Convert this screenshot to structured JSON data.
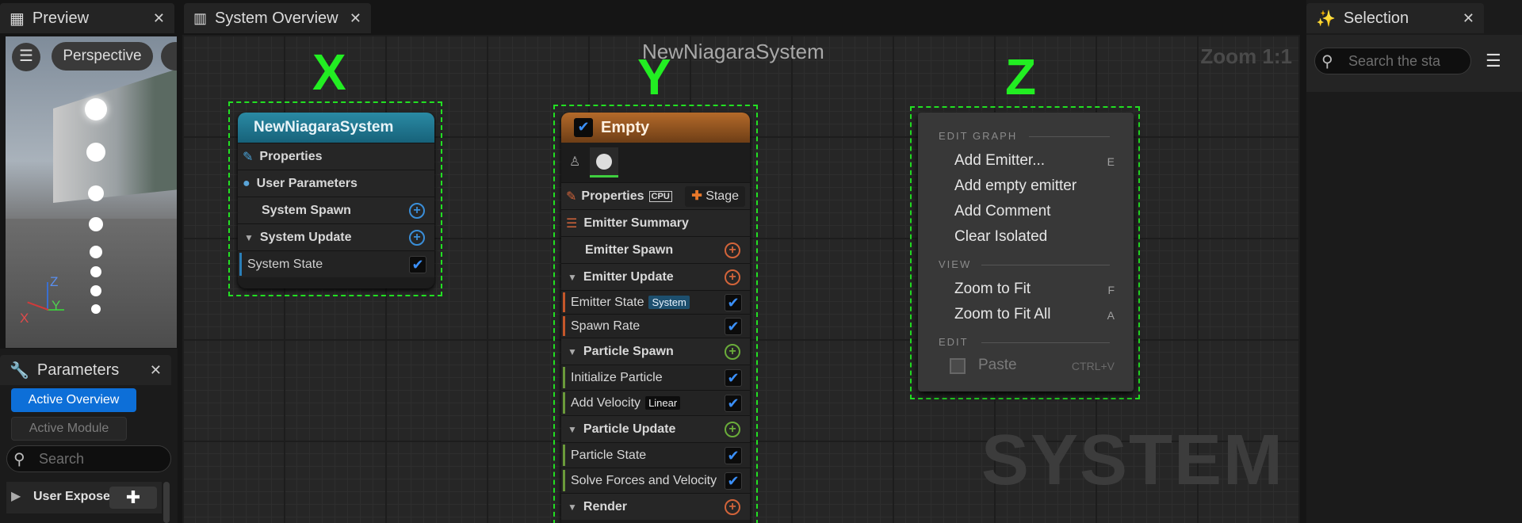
{
  "preview": {
    "tab_label": "Preview",
    "viewport_mode": "Perspective",
    "axes": {
      "z": "Z",
      "y": "Y",
      "x": "X"
    }
  },
  "parameters": {
    "tab_label": "Parameters",
    "active_overview": "Active Overview",
    "active_module": "Active Module",
    "search_placeholder": "Search",
    "user_exposed": "User Exposed"
  },
  "system_overview": {
    "tab_label": "System Overview",
    "title": "NewNiagaraSystem",
    "zoom": "Zoom 1:1",
    "watermark": "SYSTEM"
  },
  "annotations": {
    "x": "X",
    "y": "Y",
    "z": "Z"
  },
  "system_node": {
    "title": "NewNiagaraSystem",
    "rows": {
      "properties": "Properties",
      "user_parameters": "User Parameters",
      "system_spawn": "System Spawn",
      "system_update": "System Update",
      "system_state": "System State"
    }
  },
  "emitter_node": {
    "title": "Empty",
    "properties": "Properties",
    "cpu_badge": "CPU",
    "stage": "Stage",
    "emitter_summary": "Emitter Summary",
    "emitter_spawn": "Emitter Spawn",
    "emitter_update": "Emitter Update",
    "emitter_state": "Emitter State",
    "emitter_state_badge": "System",
    "spawn_rate": "Spawn Rate",
    "particle_spawn": "Particle Spawn",
    "initialize_particle": "Initialize Particle",
    "add_velocity": "Add Velocity",
    "add_velocity_badge": "Linear",
    "particle_update": "Particle Update",
    "particle_state": "Particle State",
    "solve_forces": "Solve Forces and Velocity",
    "render": "Render"
  },
  "context_menu": {
    "edit_graph": "EDIT GRAPH",
    "add_emitter": "Add Emitter...",
    "add_emitter_key": "E",
    "add_empty_emitter": "Add empty emitter",
    "add_comment": "Add Comment",
    "clear_isolated": "Clear Isolated",
    "view": "VIEW",
    "zoom_to_fit": "Zoom to Fit",
    "zoom_to_fit_key": "F",
    "zoom_to_fit_all": "Zoom to Fit All",
    "zoom_to_fit_all_key": "A",
    "edit": "EDIT",
    "paste": "Paste",
    "paste_key": "CTRL+V"
  },
  "selection": {
    "tab_label": "Selection",
    "search_placeholder": "Search the sta"
  },
  "colors": {
    "accent_green": "#22e022",
    "system_header": "#1f7a92",
    "emitter_header": "#9a5a22",
    "selected_blue": "#0d6fd8"
  }
}
